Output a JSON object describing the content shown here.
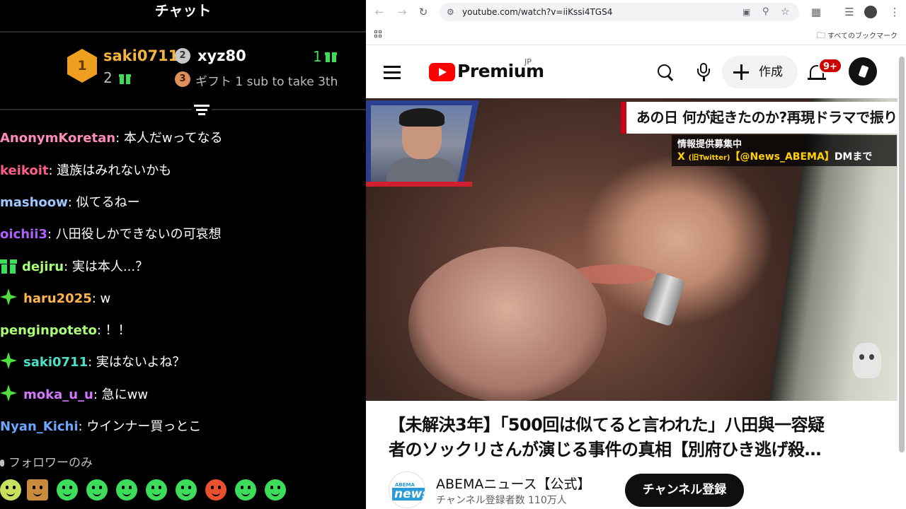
{
  "chat": {
    "header": "チャット",
    "leaderboard": {
      "first": {
        "rank": "1",
        "name": "saki0711",
        "count": "2"
      },
      "second": {
        "rank": "2",
        "name": "xyz80",
        "count": "1"
      },
      "third": {
        "rank": "3",
        "label": "ギフト 1 sub to take 3th"
      }
    },
    "messages": [
      {
        "user": "AnonymKoretan",
        "text": ": 本人だwってなる",
        "color": "#ff8bb8",
        "badge": ""
      },
      {
        "user": "keikoit",
        "text": ": 遺族はみれないかも",
        "color": "#ff5c88",
        "badge": ""
      },
      {
        "user": "mashoow",
        "text": ": 似てるねー",
        "color": "#9ec8ff",
        "badge": ""
      },
      {
        "user": "oichii3",
        "text": ": 八田役しかできないの可哀想",
        "color": "#b060ff",
        "badge": ""
      },
      {
        "user": "dejiru",
        "text": ": 実は本人...？",
        "color": "#a8ff78",
        "badge": "gift-icon"
      },
      {
        "user": "haru2025",
        "text": ": w",
        "color": "#ffb54a",
        "badge": "sparkle-icon"
      },
      {
        "user": "penginpoteto",
        "text": ": ！！",
        "color": "#a8ff78",
        "badge": ""
      },
      {
        "user": "saki0711",
        "text": ": 実はないよね？",
        "color": "#4de0c8",
        "badge": "sparkle-icon"
      },
      {
        "user": "moka_u_u",
        "text": ": 急にww",
        "color": "#d278ff",
        "badge": "sparkle-icon"
      },
      {
        "user": "Nyan_Kichi",
        "text": ": ウインナー買っとこ",
        "color": "#6aa8ff",
        "badge": ""
      }
    ],
    "followers_only": "フォロワーのみ",
    "emote_count": 10
  },
  "browser": {
    "url": "youtube.com/watch?v=iiKssi4TGS4",
    "bookmarks_all": "すべてのブックマーク"
  },
  "youtube": {
    "logo_text": "Premium",
    "region": "JP",
    "create_label": "作成",
    "notifications": "9+",
    "video": {
      "caption_main": "あの日 何が起きたのか?再現ドラマで振り返る",
      "info_line1": "情報提供募集中",
      "info_x": "X",
      "info_old": "(旧Twitter)",
      "info_handle": "【@News_ABEMA】",
      "info_dm": "DMまで"
    },
    "title_line1": "【未解決3年】「500回は似てると言われた」八田與一容疑",
    "title_line2": "者のソックリさんが演じる事件の真相【別府ひき逃げ殺…",
    "channel": {
      "avatar_top": "ABEMA",
      "avatar_main": "news/",
      "name": "ABEMAニュース【公式】",
      "subscribers": "チャンネル登録者数 110万人",
      "subscribe_label": "チャンネル登録"
    }
  }
}
